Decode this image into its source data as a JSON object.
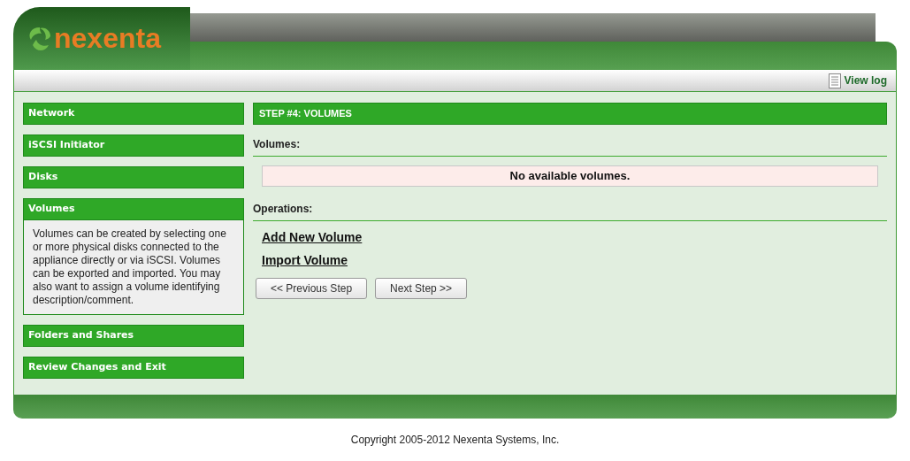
{
  "header": {
    "logo_text": "nexenta",
    "view_log": "View log"
  },
  "sidebar": {
    "items": [
      {
        "label": "Network",
        "expanded": false
      },
      {
        "label": "iSCSI Initiator",
        "expanded": false
      },
      {
        "label": "Disks",
        "expanded": false
      },
      {
        "label": "Volumes",
        "expanded": true,
        "description": "Volumes can be created by selecting one or more physical disks connected to the appliance directly or via iSCSI. Volumes can be exported and imported. You may also want to assign a volume identifying description/comment."
      },
      {
        "label": "Folders and Shares",
        "expanded": false
      },
      {
        "label": "Review Changes and Exit",
        "expanded": false
      }
    ]
  },
  "main": {
    "title": "STEP #4: VOLUMES",
    "volumes_label": "Volumes:",
    "empty_message": "No available volumes.",
    "operations_label": "Operations:",
    "operations": [
      "Add New Volume",
      "Import Volume"
    ],
    "buttons": [
      "<< Previous Step",
      "Next Step >>"
    ]
  },
  "footer": {
    "copyright": "Copyright 2005-2012 Nexenta Systems, Inc."
  }
}
